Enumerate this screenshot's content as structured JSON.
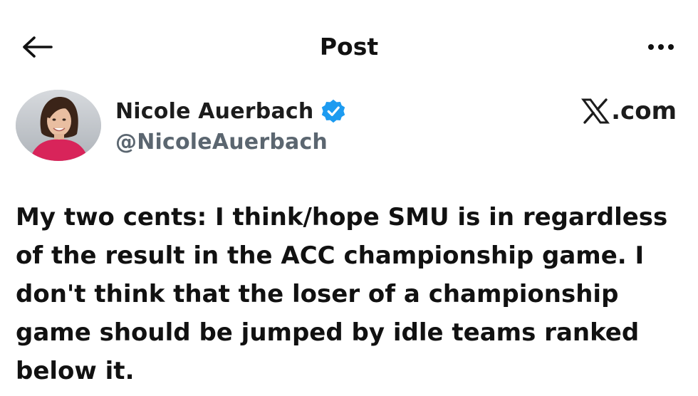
{
  "header": {
    "title": "Post",
    "back_icon": "arrow-left-icon",
    "more_icon": "more-horizontal-icon"
  },
  "author": {
    "name": "Nicole Auerbach",
    "handle": "@NicoleAuerbach",
    "verified": true,
    "verified_color": "#1d9bf0"
  },
  "brand": {
    "text": ".com",
    "logo_icon": "x-logo-icon"
  },
  "tweet": {
    "text": "My two cents: I think/hope SMU is in regardless of the result in the ACC championship game. I don't think that the loser of a championship game should be jumped by idle teams ranked below it."
  }
}
